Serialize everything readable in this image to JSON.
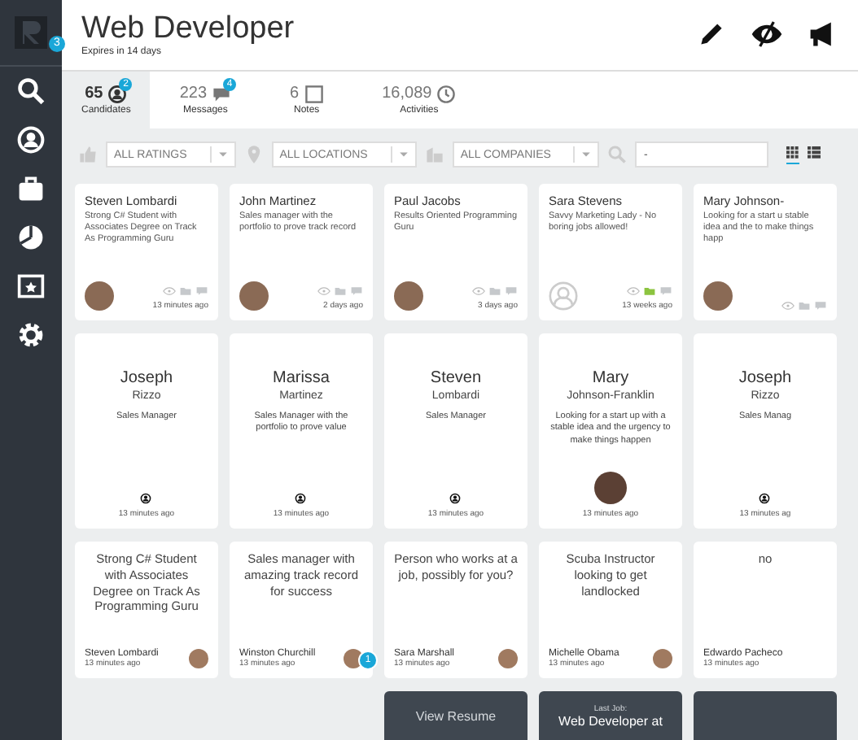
{
  "sidebar": {
    "logo_badge": "3",
    "items": [
      {
        "selected": false
      },
      {
        "selected": false
      },
      {
        "selected": false
      },
      {
        "selected": false
      },
      {
        "selected": false
      },
      {
        "selected": false
      }
    ]
  },
  "header": {
    "title": "Web Developer",
    "subtitle": "Expires in 14 days"
  },
  "stats": [
    {
      "value": "65",
      "label": "Candidates",
      "badge": "2",
      "selected": true
    },
    {
      "value": "223",
      "label": "Messages",
      "badge": "4",
      "selected": false
    },
    {
      "value": "6",
      "label": "Notes",
      "selected": false
    },
    {
      "value": "16,089",
      "label": "Activities",
      "selected": false
    }
  ],
  "filters": {
    "dropdowns": [
      {
        "value": "ALL RATINGS"
      },
      {
        "value": "ALL LOCATIONS"
      },
      {
        "value": "ALL COMPANIES"
      }
    ],
    "search": {
      "value": "-"
    },
    "views": [
      {
        "kind": "grid",
        "selected": true
      },
      {
        "kind": "list",
        "selected": false
      }
    ]
  },
  "profile_cards": [
    {
      "kind": "photo",
      "name": "Steven Lombardi",
      "summary": "Strong C# Student with Associates Degree on Track As Programming Guru",
      "shortlisted": false,
      "time": "13 minutes ago"
    },
    {
      "kind": "photo",
      "name": "John Martinez",
      "summary": "Sales manager with the portfolio to prove track record",
      "shortlisted": false,
      "time": "2 days ago"
    },
    {
      "kind": "photo",
      "name": "Paul Jacobs",
      "summary": "Results Oriented Programming Guru",
      "shortlisted": false,
      "time": "3 days ago"
    },
    {
      "kind": "placeholder",
      "name": "Sara Stevens",
      "summary": "Savvy Marketing Lady - No boring jobs allowed!",
      "shortlisted": true,
      "time": "13 weeks ago"
    },
    {
      "kind": "photo",
      "name": "Mary Johnson-",
      "summary": "Looking for a start u stable idea and the to make things happ",
      "shortlisted": false
    }
  ],
  "name_cards": [
    {
      "kind": "icon",
      "first": "Joseph",
      "last": "Rizzo",
      "title": "Sales Manager",
      "time": "13 minutes ago"
    },
    {
      "kind": "icon",
      "first": "Marissa",
      "last": "Martinez",
      "title": "Sales Manager with the portfolio to prove value",
      "time": "13 minutes ago"
    },
    {
      "kind": "icon",
      "first": "Steven",
      "last": "Lombardi",
      "title": "Sales Manager",
      "time": "13 minutes ago"
    },
    {
      "kind": "photo",
      "first": "Mary",
      "last": "Johnson-Franklin",
      "title": "Looking for a start up with a stable idea and the urgency to make things happen",
      "time": "13 minutes ago"
    },
    {
      "kind": "icon",
      "first": "Joseph",
      "last": "Rizzo",
      "title": "Sales Manag",
      "time": "13 minutes ag"
    }
  ],
  "quote_cards": [
    {
      "kind": "photo",
      "quote": "Strong C# Student with Associates Degree on Track As Programming Guru",
      "name": "Steven Lombardi",
      "time": "13 minutes ago"
    },
    {
      "kind": "photo",
      "quote": "Sales manager with amazing track record for success",
      "name": "Winston Churchill",
      "time": "13 minutes ago",
      "badge": "1"
    },
    {
      "kind": "photo",
      "quote": "Person who works at a job, possibly for you?",
      "name": "Sara Marshall",
      "time": "13 minutes ago"
    },
    {
      "kind": "photo",
      "quote": "Scuba Instructor looking to get landlocked",
      "name": "Michelle Obama",
      "time": "13 minutes ago"
    },
    {
      "kind": "text_only",
      "quote": "no",
      "name": "Edwardo Pacheco",
      "time": "13 minutes ago"
    }
  ],
  "action_panels": [
    {
      "kind": "empty"
    },
    {
      "kind": "empty"
    },
    {
      "kind": "button",
      "label": "View Resume"
    },
    {
      "kind": "last_job",
      "caption": "Last Job:",
      "value": "Web Developer at"
    },
    {
      "kind": "blank"
    }
  ]
}
